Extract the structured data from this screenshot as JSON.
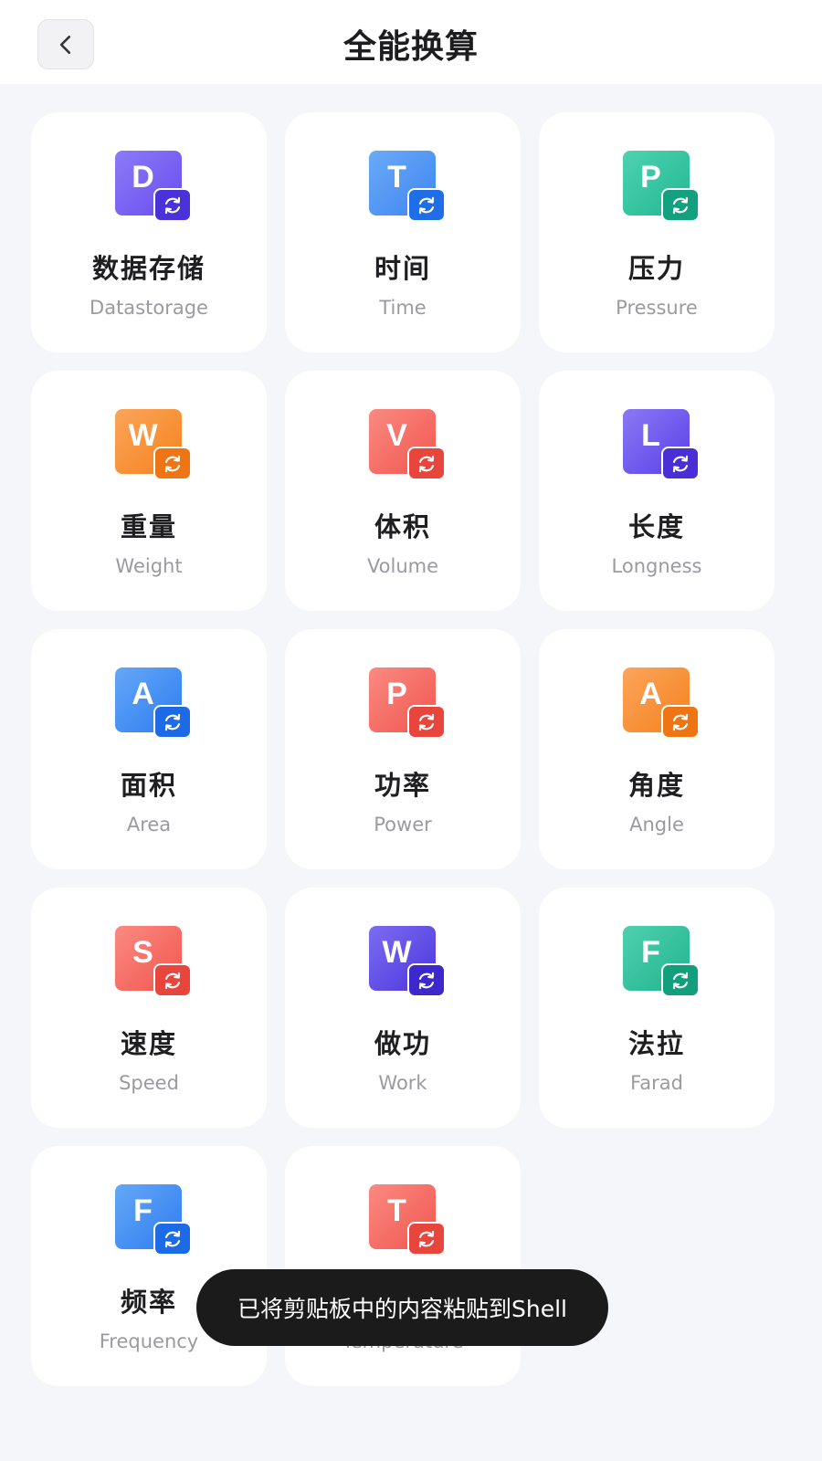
{
  "header": {
    "title": "全能换算",
    "back_icon": "chevron-left-icon"
  },
  "cards": [
    {
      "title": "数据存储",
      "subtitle": "Datastorage",
      "letter": "D",
      "color": "#6a4cf0",
      "color_light": "#8b7bf7",
      "badge_color": "#4a32d8"
    },
    {
      "title": "时间",
      "subtitle": "Time",
      "letter": "T",
      "color": "#3d86f0",
      "color_light": "#6aaaf7",
      "badge_color": "#1f6ee8"
    },
    {
      "title": "压力",
      "subtitle": "Pressure",
      "letter": "P",
      "color": "#20b893",
      "color_light": "#4fd2b0",
      "badge_color": "#13a07e"
    },
    {
      "title": "重量",
      "subtitle": "Weight",
      "letter": "W",
      "color": "#f4821f",
      "color_light": "#fca55a",
      "badge_color": "#ee7514"
    },
    {
      "title": "体积",
      "subtitle": "Volume",
      "letter": "V",
      "color": "#f0564e",
      "color_light": "#fb8a82",
      "badge_color": "#e8453d"
    },
    {
      "title": "长度",
      "subtitle": "Longness",
      "letter": "L",
      "color": "#5a40e8",
      "color_light": "#8a78f5",
      "badge_color": "#4a2fd6"
    },
    {
      "title": "面积",
      "subtitle": "Area",
      "letter": "A",
      "color": "#2d7cf0",
      "color_light": "#65a8f8",
      "badge_color": "#1d6ae6"
    },
    {
      "title": "功率",
      "subtitle": "Power",
      "letter": "P",
      "color": "#f0564e",
      "color_light": "#fb8a82",
      "badge_color": "#e8453d"
    },
    {
      "title": "角度",
      "subtitle": "Angle",
      "letter": "A",
      "color": "#f4821f",
      "color_light": "#fca55a",
      "badge_color": "#ee7514"
    },
    {
      "title": "速度",
      "subtitle": "Speed",
      "letter": "S",
      "color": "#f0564e",
      "color_light": "#fb8a82",
      "badge_color": "#e8453d"
    },
    {
      "title": "做功",
      "subtitle": "Work",
      "letter": "W",
      "color": "#4a36dc",
      "color_light": "#7d6cf2",
      "badge_color": "#3c28cc"
    },
    {
      "title": "法拉",
      "subtitle": "Farad",
      "letter": "F",
      "color": "#1fb48e",
      "color_light": "#50d0ae",
      "badge_color": "#12a07c"
    },
    {
      "title": "频率",
      "subtitle": "Frequency",
      "letter": "F",
      "color": "#2d7cf0",
      "color_light": "#65a8f8",
      "badge_color": "#1d6ae6"
    },
    {
      "title": "",
      "subtitle": "Temperature",
      "letter": "T",
      "color": "#f0564e",
      "color_light": "#fb8a82",
      "badge_color": "#e8453d"
    }
  ],
  "toast": {
    "text": "已将剪贴板中的内容粘贴到Shell"
  }
}
